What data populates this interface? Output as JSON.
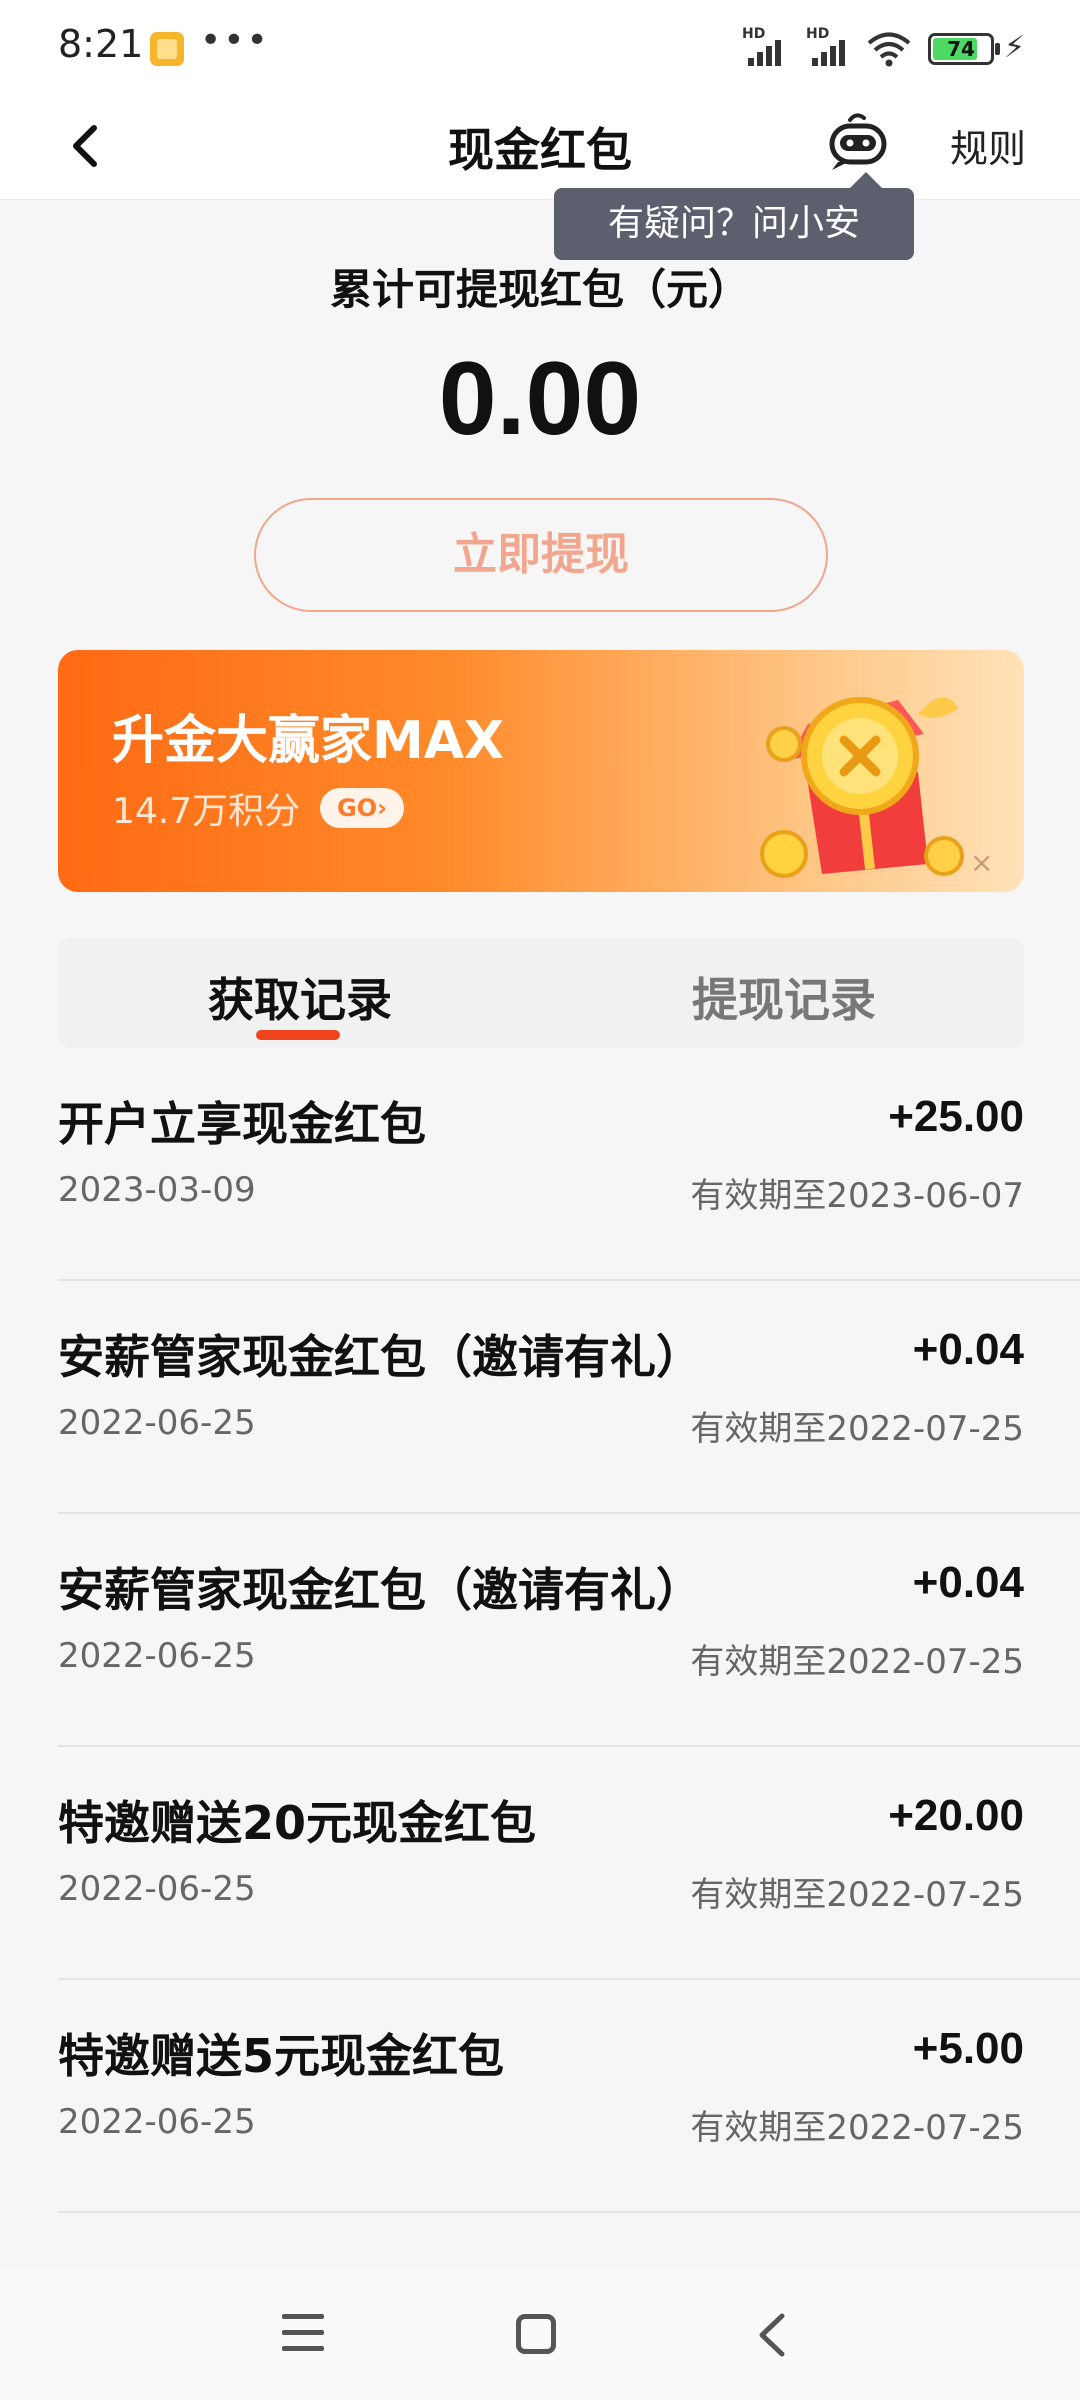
{
  "status_bar": {
    "time": "8:21",
    "more": "•••",
    "signal_label": "HD",
    "battery": "74"
  },
  "header": {
    "title": "现金红包",
    "rules": "规则",
    "tooltip": "有疑问？问小安"
  },
  "balance": {
    "label": "累计可提现红包（元）",
    "amount": "0.00",
    "withdraw_button": "立即提现"
  },
  "banner": {
    "title": "升金大赢家MAX",
    "subtitle": "14.7万积分",
    "go": "GO›",
    "close": "×"
  },
  "tabs": [
    {
      "label": "获取记录",
      "active": true
    },
    {
      "label": "提现记录",
      "active": false
    }
  ],
  "records": [
    {
      "title": "开户立享现金红包",
      "date": "2023-03-09",
      "amount": "+25.00",
      "expiry": "有效期至2023-06-07"
    },
    {
      "title": "安薪管家现金红包（邀请有礼）",
      "date": "2022-06-25",
      "amount": "+0.04",
      "expiry": "有效期至2022-07-25"
    },
    {
      "title": "安薪管家现金红包（邀请有礼）",
      "date": "2022-06-25",
      "amount": "+0.04",
      "expiry": "有效期至2022-07-25"
    },
    {
      "title": "特邀赠送20元现金红包",
      "date": "2022-06-25",
      "amount": "+20.00",
      "expiry": "有效期至2022-07-25"
    },
    {
      "title": "特邀赠送5元现金红包",
      "date": "2022-06-25",
      "amount": "+5.00",
      "expiry": "有效期至2022-07-25"
    }
  ],
  "colors": {
    "accent": "#f1441d",
    "button_outline": "#f3a68e",
    "banner_start": "#ff6a13",
    "banner_end": "#ffe2b8"
  }
}
